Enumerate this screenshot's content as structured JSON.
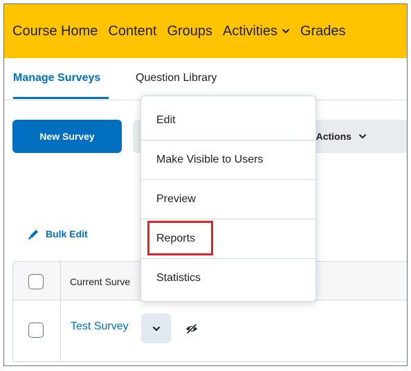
{
  "nav": {
    "items": [
      "Course Home",
      "Content",
      "Groups",
      "Activities",
      "Grades"
    ],
    "activities_icon": "chevron-down-icon"
  },
  "tabs": [
    {
      "label": "Manage Surveys",
      "active": true
    },
    {
      "label": "Question Library",
      "active": false
    }
  ],
  "toolbar": {
    "new_survey": "New Survey",
    "more_actions": "re Actions"
  },
  "bulk_edit": {
    "label": "Bulk Edit",
    "icon": "pencil-icon"
  },
  "table": {
    "column_header": "Current Surve",
    "rows": [
      {
        "name": "Test Survey",
        "status_icon": "eye-slash-icon"
      }
    ]
  },
  "menu": {
    "items": [
      "Edit",
      "Make Visible to Users",
      "Preview",
      "Reports",
      "Statistics"
    ],
    "highlighted": "Reports"
  },
  "colors": {
    "nav_bg": "#ffc300",
    "accent": "#006fbf",
    "highlight": "#e0202a"
  }
}
